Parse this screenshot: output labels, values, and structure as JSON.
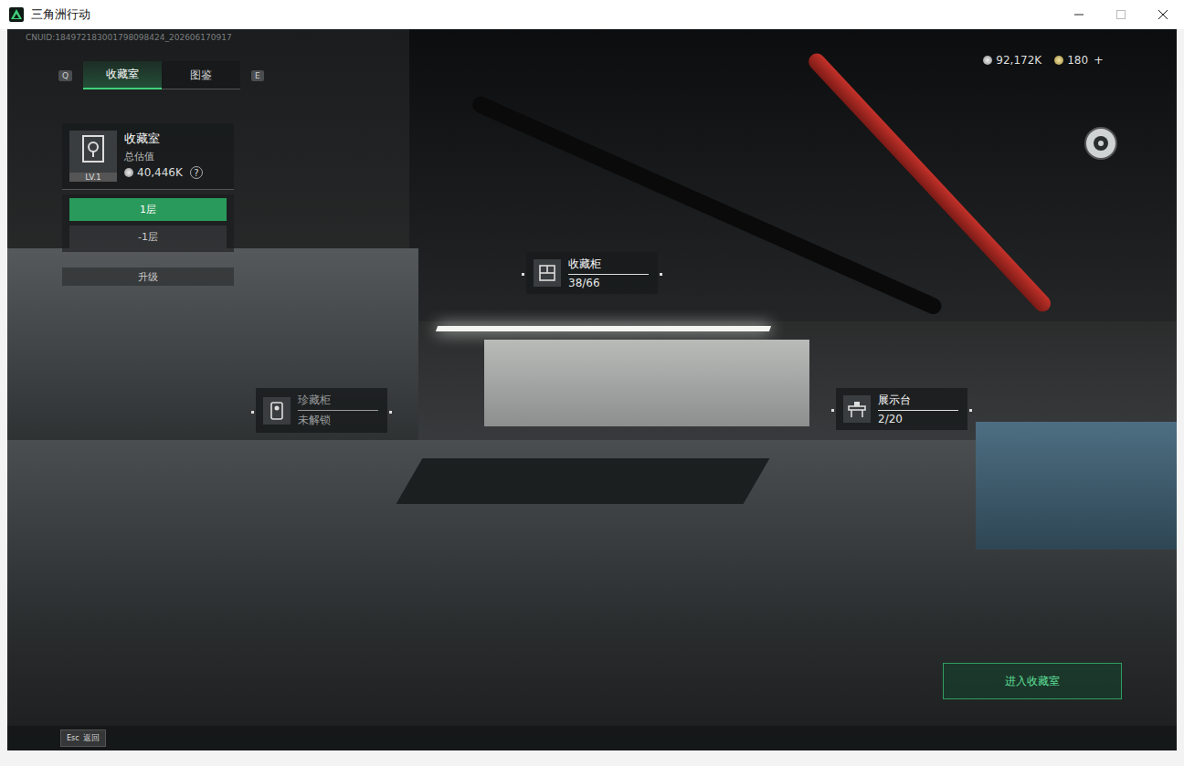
{
  "window": {
    "title": "三角洲行动"
  },
  "uid": "CNUID:184972183001798098424_202606170917",
  "tabs": {
    "prev_key": "Q",
    "next_key": "E",
    "items": [
      {
        "label": "收藏室",
        "selected": true
      },
      {
        "label": "图鉴",
        "selected": false
      }
    ]
  },
  "room_card": {
    "title": "收藏室",
    "level": "LV.1",
    "value_label": "总估值",
    "value": "40,446K",
    "help": "?"
  },
  "floors": [
    {
      "label": "1层",
      "selected": true
    },
    {
      "label": "-1层",
      "selected": false
    }
  ],
  "upgrade": "升级",
  "currency": [
    {
      "amount": "92,172K"
    },
    {
      "amount": "180"
    }
  ],
  "currency_add": "+",
  "hotspots": [
    {
      "name": "收藏柜",
      "status": "38/66",
      "kind": "cabinet",
      "locked": false
    },
    {
      "name": "珍藏柜",
      "status": "未解锁",
      "kind": "vault",
      "locked": true
    },
    {
      "name": "展示台",
      "status": "2/20",
      "kind": "display",
      "locked": false
    }
  ],
  "enter_button": "进入收藏室",
  "back": {
    "key": "Esc",
    "label": "返回"
  }
}
